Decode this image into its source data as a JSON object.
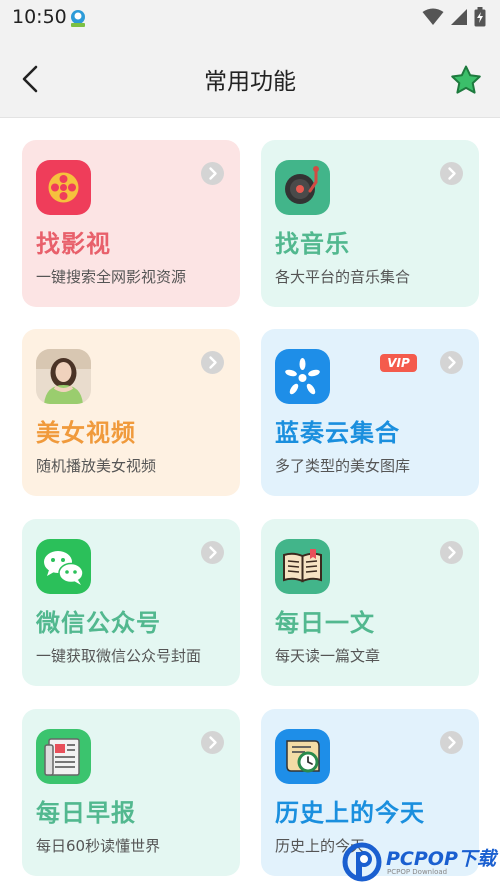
{
  "status_bar": {
    "time": "10:50"
  },
  "header": {
    "title": "常用功能"
  },
  "cards": [
    {
      "title": "找影视",
      "desc": "一键搜索全网影视资源",
      "title_color": "#e8606b",
      "bg": "#fce4e4",
      "icon": "film-reel-icon"
    },
    {
      "title": "找音乐",
      "desc": "各大平台的音乐集合",
      "title_color": "#52b88f",
      "bg": "#e4f7f2",
      "icon": "record-player-icon"
    },
    {
      "title": "美女视频",
      "desc": "随机播放美女视频",
      "title_color": "#f09a3c",
      "bg": "#fef1e2",
      "icon": "portrait-thumbnail"
    },
    {
      "title": "蓝奏云集合",
      "desc": "多了类型的美女图库",
      "title_color": "#1a8fde",
      "bg": "#e2f2fc",
      "icon": "lanzou-cloud-icon",
      "badge": "VIP"
    },
    {
      "title": "微信公众号",
      "desc": "一键获取微信公众号封面",
      "title_color": "#52b88f",
      "bg": "#e4f7f2",
      "icon": "wechat-icon"
    },
    {
      "title": "每日一文",
      "desc": "每天读一篇文章",
      "title_color": "#52b88f",
      "bg": "#e4f7f2",
      "icon": "open-book-icon"
    },
    {
      "title": "每日早报",
      "desc": "每日60秒读懂世界",
      "title_color": "#52b88f",
      "bg": "#e4f7f2",
      "icon": "newspaper-icon"
    },
    {
      "title": "历史上的今天",
      "desc": "历史上的今天",
      "title_color": "#1a8fde",
      "bg": "#e2f2fc",
      "icon": "history-scroll-icon"
    }
  ],
  "watermark": {
    "text": "PCPOP下载",
    "sub": "PCPOP Download"
  }
}
